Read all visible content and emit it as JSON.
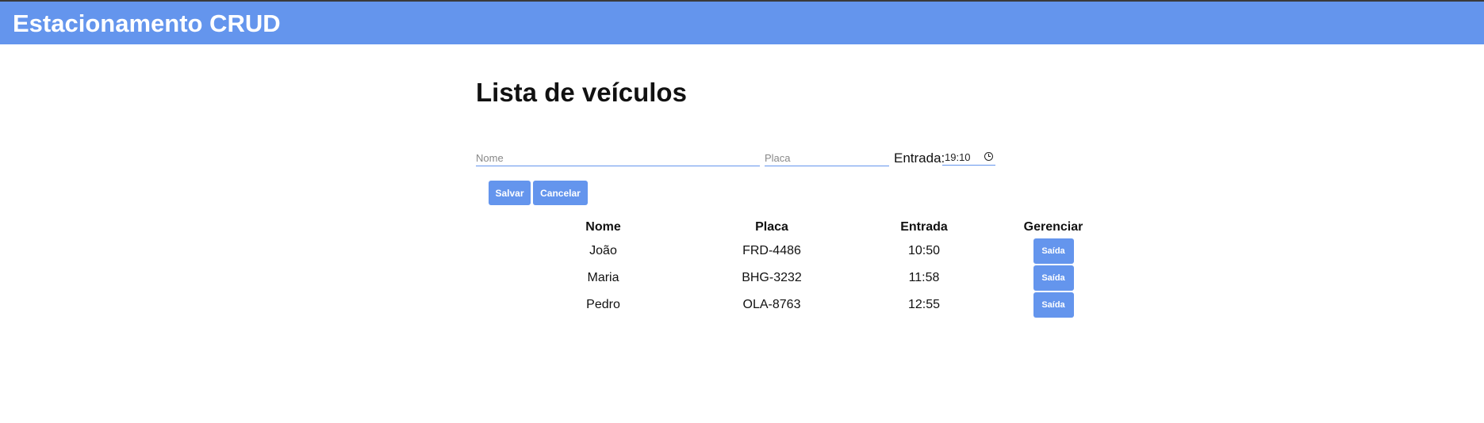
{
  "header": {
    "title": "Estacionamento CRUD",
    "background_color": "#6495ed"
  },
  "main": {
    "title": "Lista de veículos"
  },
  "form": {
    "name_placeholder": "Nome",
    "name_value": "",
    "plate_placeholder": "Placa",
    "plate_value": "",
    "entry_label": "Entrada:",
    "entry_time": "19:10",
    "entry_icon": "clock-icon",
    "save_label": "Salvar",
    "cancel_label": "Cancelar"
  },
  "table": {
    "headers": {
      "nome": "Nome",
      "placa": "Placa",
      "entrada": "Entrada",
      "gerenciar": "Gerenciar"
    },
    "rows": [
      {
        "nome": "João",
        "placa": "FRD-4486",
        "entrada": "10:50",
        "action": "Saída"
      },
      {
        "nome": "Maria",
        "placa": "BHG-3232",
        "entrada": "11:58",
        "action": "Saída"
      },
      {
        "nome": "Pedro",
        "placa": "OLA-8763",
        "entrada": "12:55",
        "action": "Saída"
      }
    ]
  },
  "colors": {
    "accent": "#6495ed",
    "button_text": "#ffffff"
  }
}
